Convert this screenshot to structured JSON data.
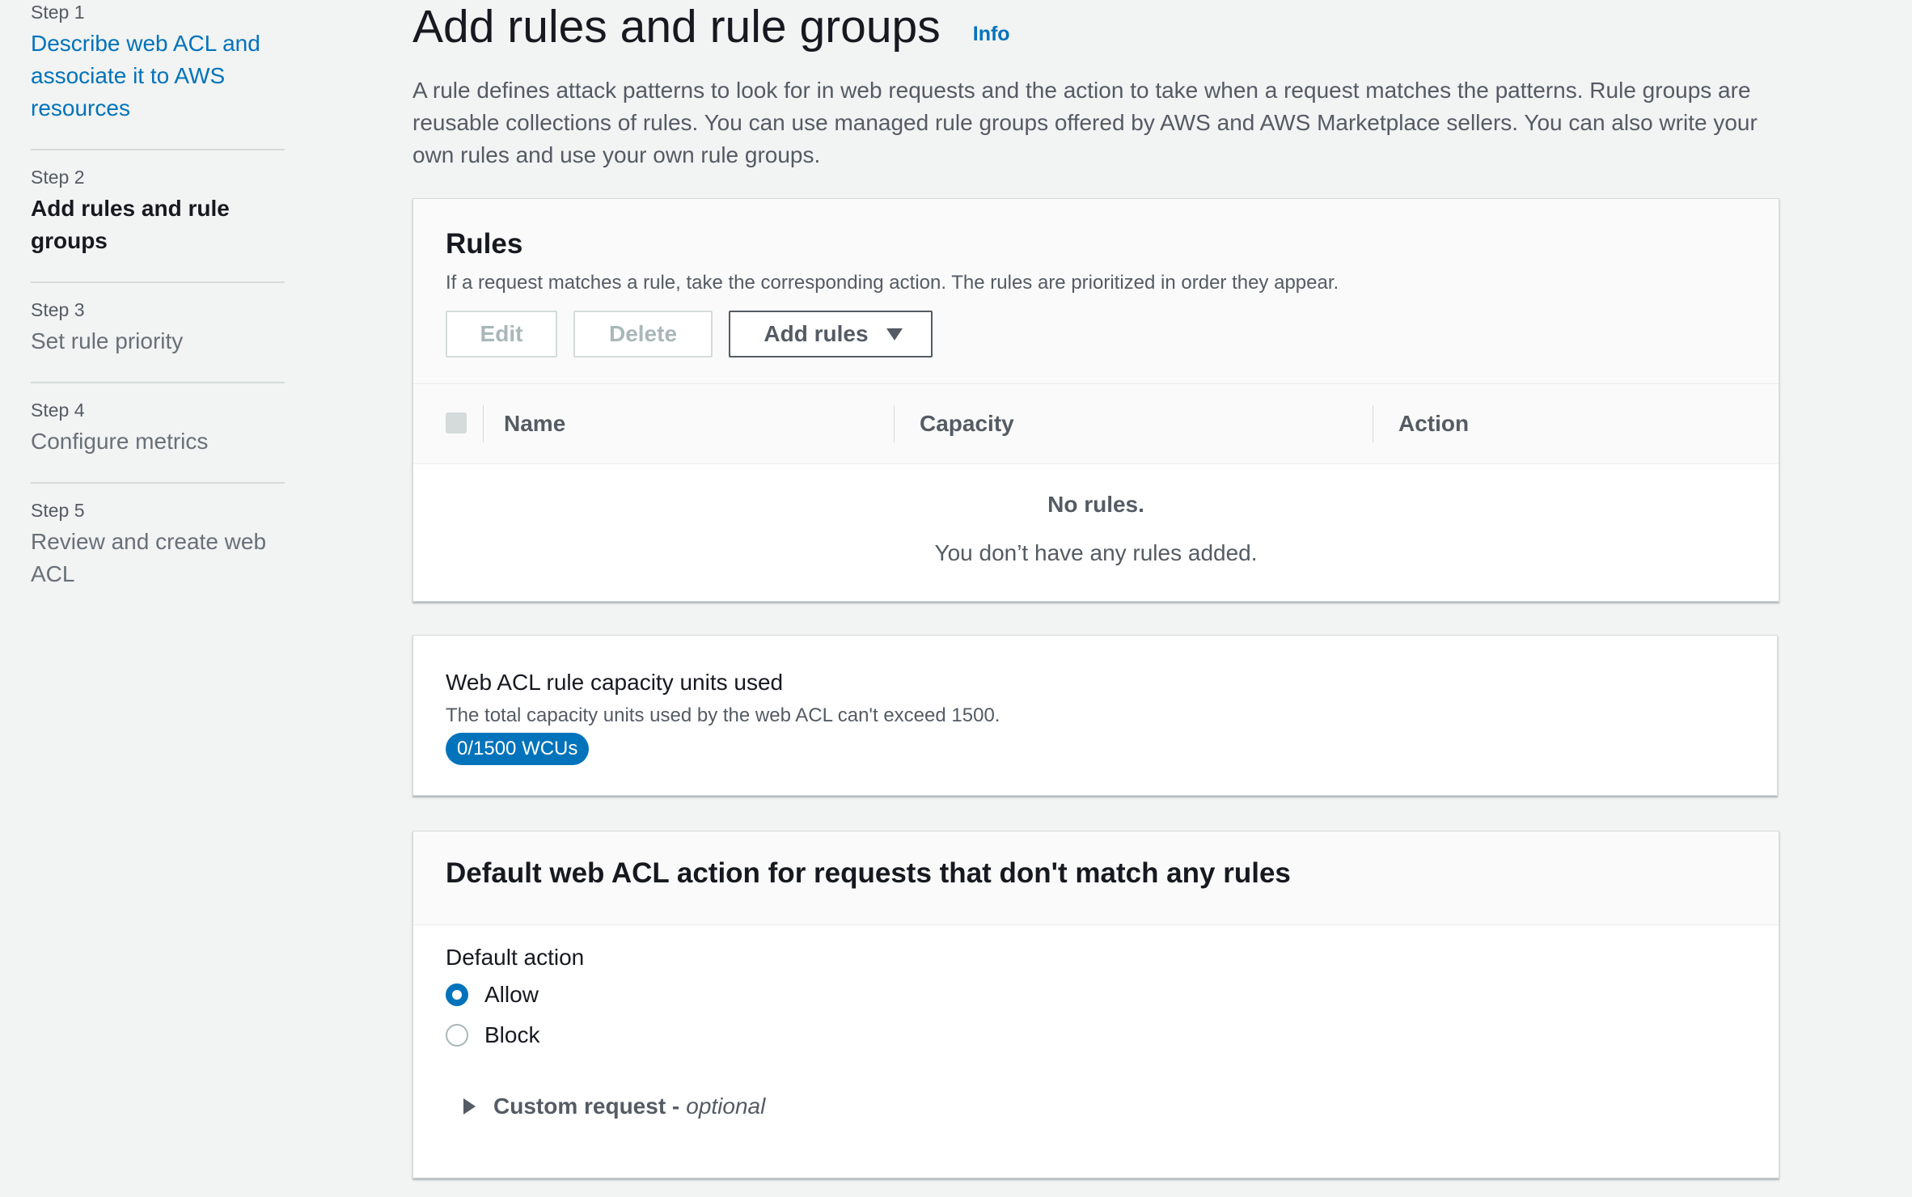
{
  "wizard": {
    "steps": [
      {
        "num": "Step 1",
        "title": "Describe web ACL and associate it to AWS resources"
      },
      {
        "num": "Step 2",
        "title": "Add rules and rule groups"
      },
      {
        "num": "Step 3",
        "title": "Set rule priority"
      },
      {
        "num": "Step 4",
        "title": "Configure metrics"
      },
      {
        "num": "Step 5",
        "title": "Review and create web ACL"
      }
    ]
  },
  "header": {
    "title": "Add rules and rule groups",
    "info": "Info",
    "description": "A rule defines attack patterns to look for in web requests and the action to take when a request matches the patterns. Rule groups are reusable collections of rules. You can use managed rule groups offered by AWS and AWS Marketplace sellers. You can also write your own rules and use your own rule groups."
  },
  "rules": {
    "title": "Rules",
    "description": "If a request matches a rule, take the corresponding action. The rules are prioritized in order they appear.",
    "edit_label": "Edit",
    "delete_label": "Delete",
    "add_rules_label": "Add rules",
    "columns": [
      "Name",
      "Capacity",
      "Action"
    ],
    "empty_title": "No rules.",
    "empty_message": "You don’t have any rules added."
  },
  "capacity": {
    "title": "Web ACL rule capacity units used",
    "description": "The total capacity units used by the web ACL can't exceed 1500.",
    "badge": "0/1500 WCUs"
  },
  "default_action": {
    "title": "Default web ACL action for requests that don't match any rules",
    "field_label": "Default action",
    "options": [
      "Allow",
      "Block"
    ],
    "selected": "Allow",
    "custom_request_label": "Custom request -",
    "custom_request_optional": "optional"
  },
  "colors": {
    "link": "#0073bb",
    "background": "#f2f3f3",
    "badge": "#0073bb"
  }
}
